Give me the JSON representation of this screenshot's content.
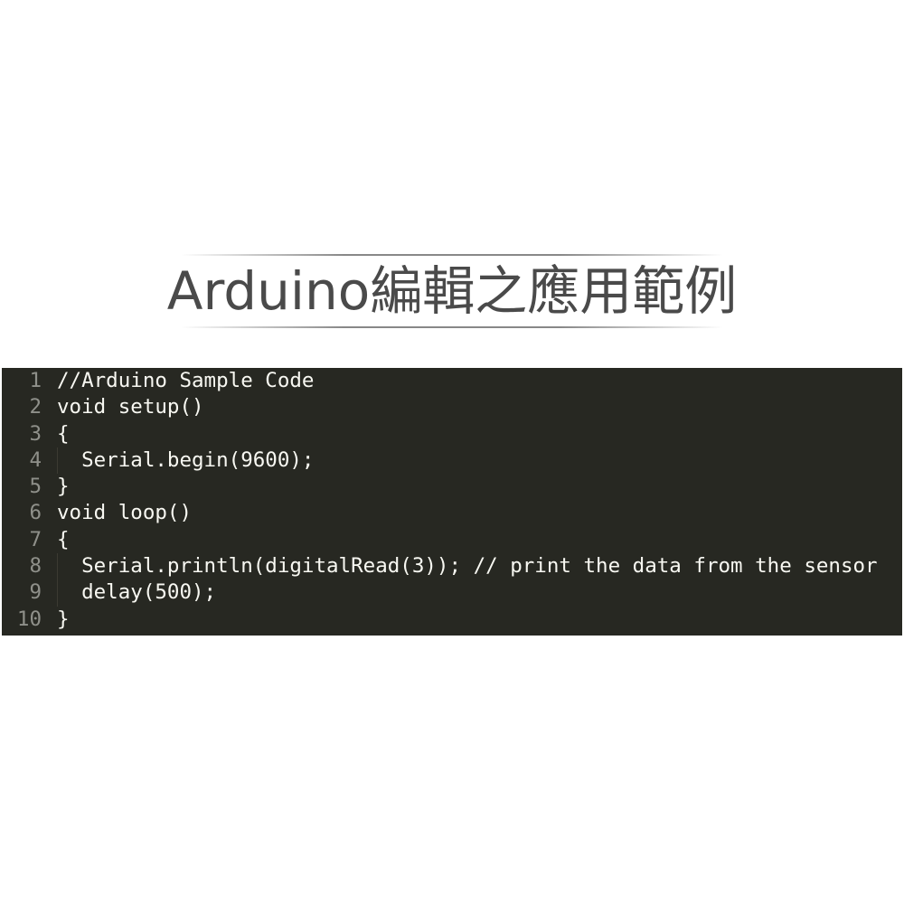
{
  "title": "Arduino編輯之應用範例",
  "code": {
    "lines": [
      {
        "number": "1",
        "text": "//Arduino Sample Code"
      },
      {
        "number": "2",
        "text": "void setup()"
      },
      {
        "number": "3",
        "text": "{"
      },
      {
        "number": "4",
        "text": "  Serial.begin(9600);"
      },
      {
        "number": "5",
        "text": "}"
      },
      {
        "number": "6",
        "text": "void loop()"
      },
      {
        "number": "7",
        "text": "{"
      },
      {
        "number": "8",
        "text": "  Serial.println(digitalRead(3)); // print the data from the sensor"
      },
      {
        "number": "9",
        "text": "  delay(500);"
      },
      {
        "number": "10",
        "text": "}"
      }
    ],
    "colors": {
      "background": "#272822",
      "text": "#f8f8f2",
      "line_number": "#8f908a"
    }
  }
}
